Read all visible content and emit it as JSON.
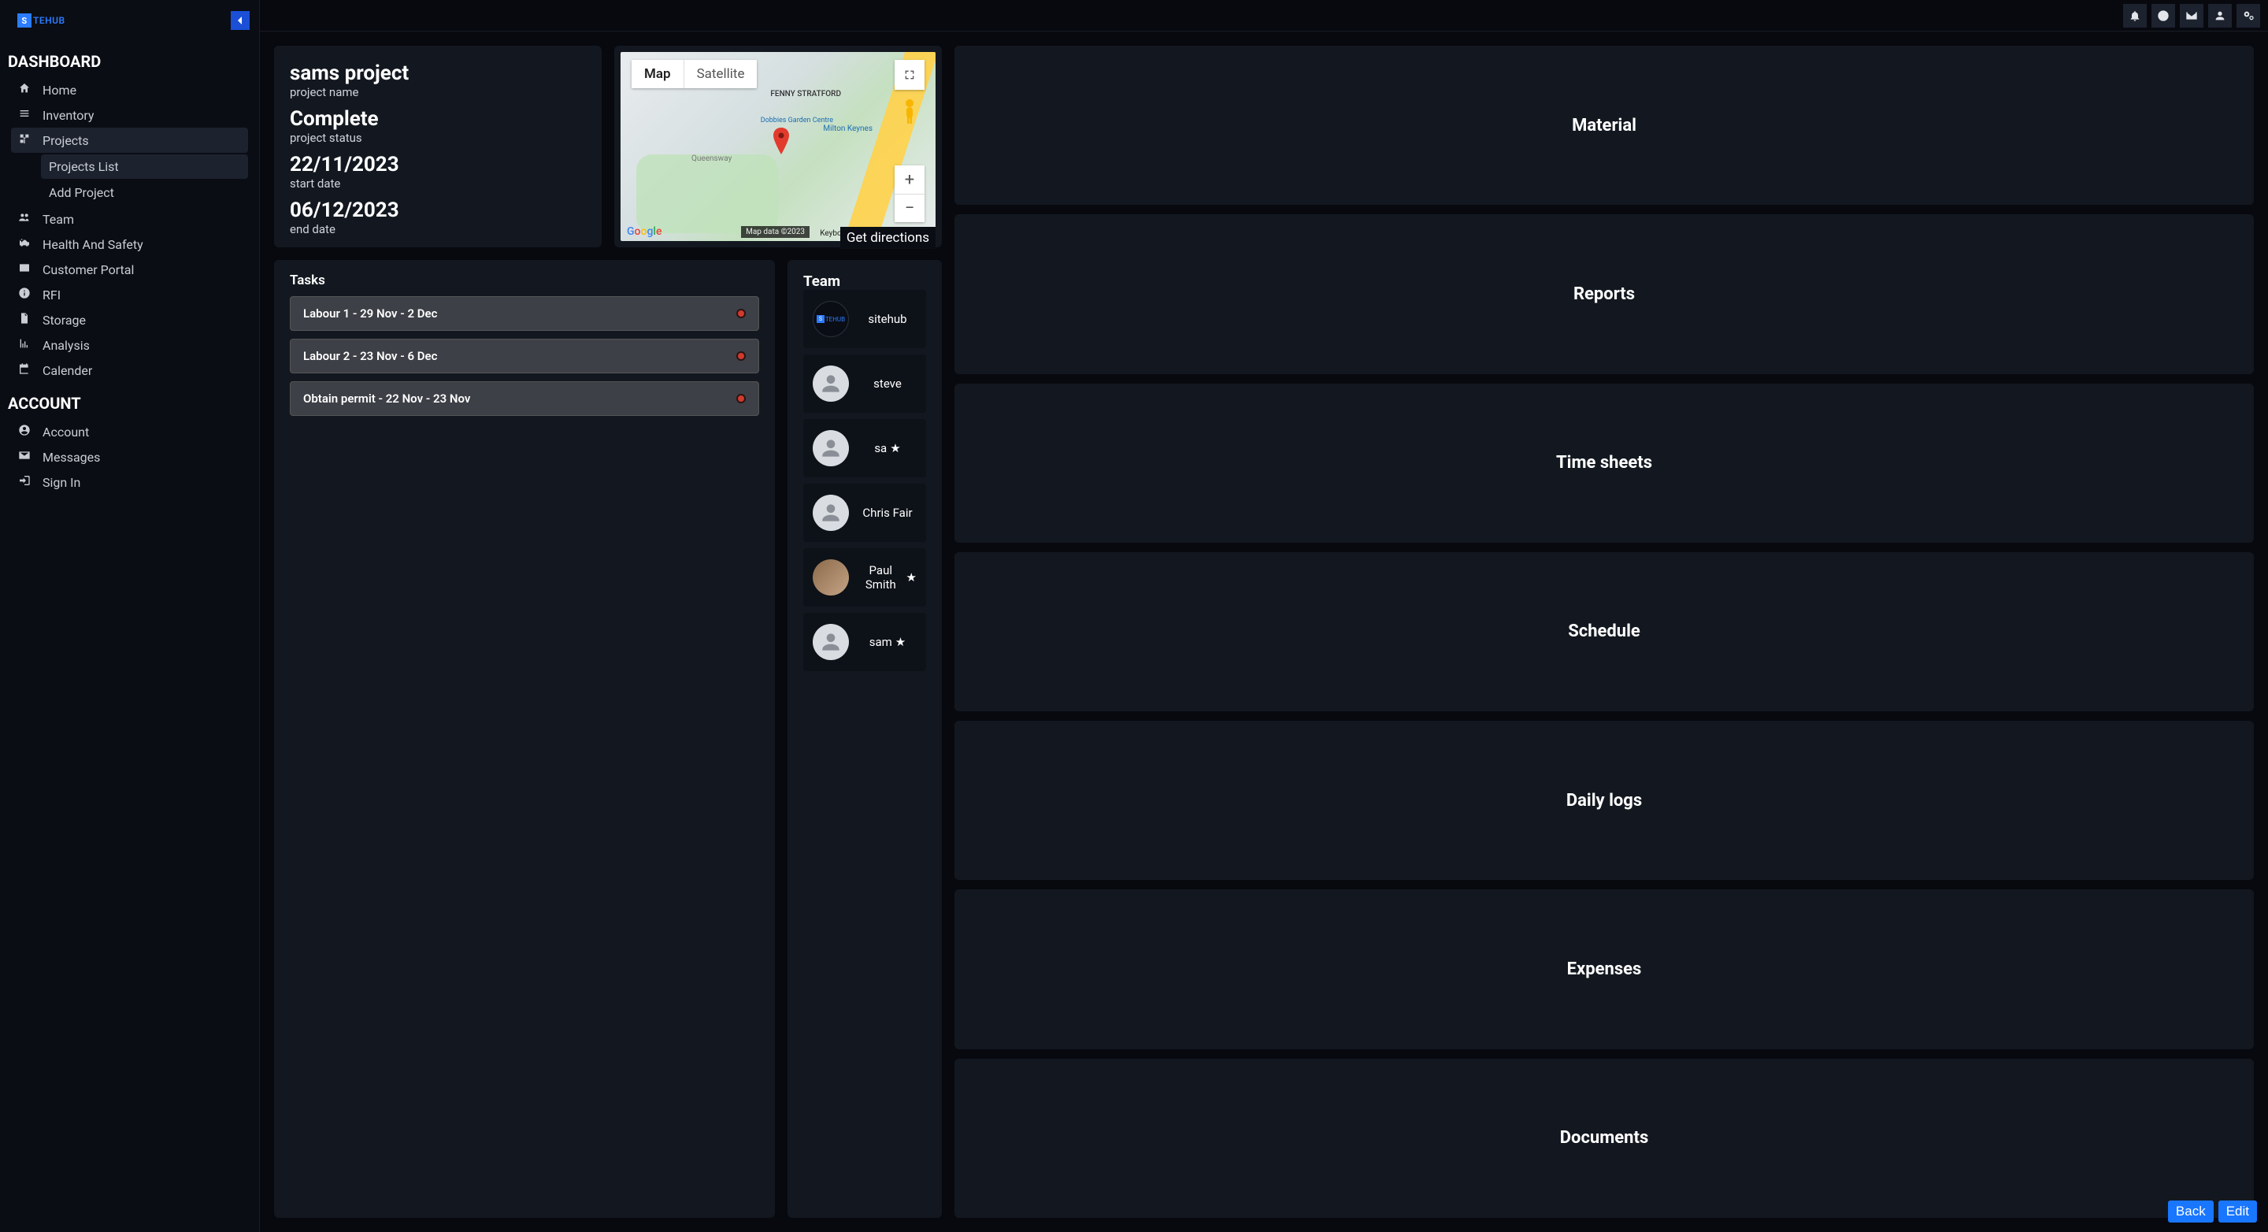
{
  "brand": "TEHUB",
  "sidebar": {
    "section_dashboard": "DASHBOARD",
    "section_account": "ACCOUNT",
    "items": {
      "home": "Home",
      "inventory": "Inventory",
      "projects": "Projects",
      "projects_list": "Projects List",
      "add_project": "Add Project",
      "team": "Team",
      "health_safety": "Health And Safety",
      "customer_portal": "Customer Portal",
      "rfi": "RFI",
      "storage": "Storage",
      "analysis": "Analysis",
      "calendar": "Calender",
      "account": "Account",
      "messages": "Messages",
      "sign_in": "Sign In"
    }
  },
  "project": {
    "name_value": "sams project",
    "name_label": "project name",
    "status_value": "Complete",
    "status_label": "project status",
    "start_value": "22/11/2023",
    "start_label": "start date",
    "end_value": "06/12/2023",
    "end_label": "end date"
  },
  "map": {
    "map_label": "Map",
    "satellite_label": "Satellite",
    "attr": "Map data ©2023",
    "kbd": "Keyboard shortcuts",
    "place1": "FENNY STRATFORD",
    "place2": "Milton Keynes",
    "place3": "Queensway",
    "place4": "Dobbies Garden Centre",
    "directions": "Get directions"
  },
  "tasks": {
    "heading": "Tasks",
    "list": [
      "Labour 1 - 29 Nov - 2 Dec",
      "Labour 2 - 23 Nov - 6 Dec",
      "Obtain permit - 22 Nov - 23 Nov"
    ]
  },
  "team": {
    "heading": "Team",
    "members": [
      {
        "name": "sitehub",
        "starred": false,
        "type": "logo"
      },
      {
        "name": "steve",
        "starred": false,
        "type": "default"
      },
      {
        "name": "sa",
        "starred": true,
        "type": "default"
      },
      {
        "name": "Chris Fair",
        "starred": false,
        "type": "default"
      },
      {
        "name": "Paul Smith",
        "starred": true,
        "type": "photo"
      },
      {
        "name": "sam",
        "starred": true,
        "type": "default"
      }
    ]
  },
  "tiles": [
    "Material",
    "Reports",
    "Time sheets",
    "Schedule",
    "Daily logs",
    "Expenses",
    "Documents"
  ],
  "footer": {
    "back": "Back",
    "edit": "Edit"
  }
}
